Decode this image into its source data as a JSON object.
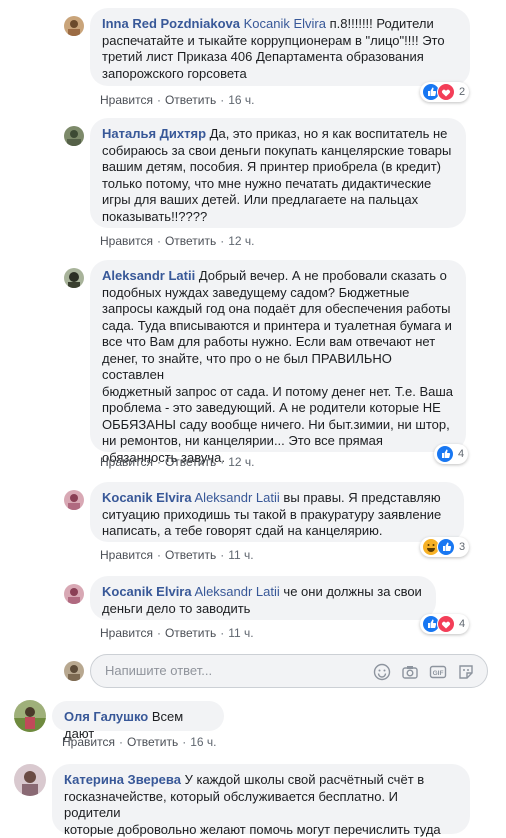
{
  "comments": [
    {
      "author": "Inna Red Pozdniakova",
      "mention": "Kocanik Elvira",
      "lines": [
        "п.8!!!!!!! Родители",
        "распечатайте и тыкайте коррупционерам в \"лицо\"!!!! Это",
        "третий лист Приказа 406 Департамента образования",
        "запорожского горсовета"
      ],
      "like": "Нравится",
      "reply": "Ответить",
      "time": "16 ч.",
      "reaction_count": "2"
    },
    {
      "author": "Наталья Дихтяр",
      "lines": [
        "Да, это приказ, но я как воспитатель не",
        "собираюсь за свои деньги покупать канцелярские товары",
        "вашим детям, пособия. Я принтер приобрела (в кредит)",
        "только потому, что мне нужно печатать дидактические",
        "игры для ваших детей. Или предлагаете на пальцах",
        "показывать!!????"
      ],
      "like": "Нравится",
      "reply": "Ответить",
      "time": "12 ч."
    },
    {
      "author": "Aleksandr Latii",
      "lines": [
        "Добрый вечер. А не пробовали сказать о",
        "подобных нуждах заведущему садом? Бюджетные",
        "запросы каждый год она подаёт для обеспечения работы",
        "сада. Туда вписываются и принтера и туалетная бумага и",
        "все что Вам для работы нужно. Если вам отвечают нет",
        "денег, то знайте, что про о не был ПРАВИЛЬНО составлен",
        "бюджетный запрос от сада. И потому денег нет. Т.е. Ваша",
        "проблема - это заведующий. А не родители которые НЕ",
        "ОББЯЗАНЫ саду вообще ничего. Ни быт.зимии, ни штор,",
        "ни ремонтов, ни канцелярии... Это все прямая",
        "обязанность завуча."
      ],
      "like": "Нравится",
      "reply": "Ответить",
      "time": "12 ч.",
      "reaction_count": "4"
    },
    {
      "author": "Kocanik Elvira",
      "mention": "Aleksandr Latii",
      "lines": [
        "вы правы. Я представляю",
        "ситуацию приходишь ты такой в пракуратуру заявление",
        "написать, а тебе говорят сдай на канцелярию."
      ],
      "like": "Нравится",
      "reply": "Ответить",
      "time": "11 ч.",
      "reaction_count": "3"
    },
    {
      "author": "Kocanik Elvira",
      "mention": "Aleksandr Latii",
      "lines": [
        "че они должны за свои",
        "деньги дело то заводить"
      ],
      "like": "Нравится",
      "reply": "Ответить",
      "time": "11 ч.",
      "reaction_count": "4"
    },
    {
      "author": "Оля Галушко",
      "lines": [
        "Всем дают"
      ],
      "like": "Нравится",
      "reply": "Ответить",
      "time": "16 ч."
    },
    {
      "author": "Катерина Зверева",
      "lines": [
        "У каждой школы свой расчётный счёт в",
        "госказначействе, который обслуживается бесплатно. И родители",
        "которые добровольно желают помочь могут перечислить туда"
      ]
    }
  ],
  "reply_box": {
    "placeholder": "Напишите ответ..."
  },
  "colors": {
    "link": "#385898",
    "bubble": "#f2f3f5",
    "like_blue": "#1877f2",
    "love_red": "#f33e58",
    "haha_yellow": "#f7b125"
  },
  "icons": [
    "like-icon",
    "love-icon",
    "haha-icon",
    "emoji-icon",
    "camera-icon",
    "gif-icon",
    "sticker-icon"
  ]
}
